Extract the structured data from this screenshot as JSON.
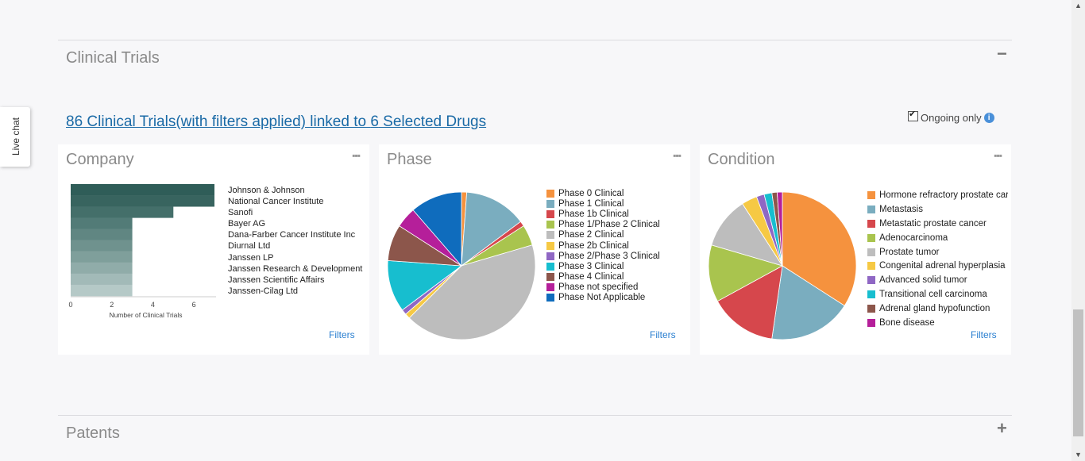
{
  "clinical_trials_section": {
    "title": "Clinical Trials",
    "collapse_icon": "minus-icon",
    "summary": {
      "count": "86",
      "text1": " Clinical Trials(with filters applied) linked to ",
      "drugs": "6",
      "text2": " Selected Drugs"
    },
    "ongoing_label": "Ongoing only",
    "ongoing_checked": true
  },
  "live_chat": {
    "label": "Live chat"
  },
  "patents_section": {
    "title": "Patents",
    "expand_icon": "plus-icon"
  },
  "company_card": {
    "title": "Company",
    "filters_label": "Filters",
    "menu_icon": "ellipsis-icon",
    "xlabel": "Number of Clinical Trials",
    "ticks": [
      "0",
      "2",
      "4",
      "6"
    ],
    "xlim": [
      0,
      7
    ],
    "companies": [
      "Johnson & Johnson",
      "National Cancer Institute",
      "Sanofi",
      "Bayer AG",
      "Dana-Farber Cancer Institute Inc",
      "Diurnal Ltd",
      "Janssen LP",
      "Janssen Research & Development L",
      "Janssen Scientific Affairs",
      "Janssen-Cilag Ltd"
    ],
    "values": [
      7,
      7,
      5,
      3,
      3,
      3,
      3,
      3,
      3,
      3
    ],
    "colors": [
      "#2f5d58",
      "#38645f",
      "#446f6a",
      "#527b77",
      "#608682",
      "#6f928e",
      "#7f9f9b",
      "#90aca9",
      "#a2bab8",
      "#b5c9c7"
    ]
  },
  "phase_card": {
    "title": "Phase",
    "filters_label": "Filters",
    "menu_icon": "ellipsis-icon",
    "legend": [
      {
        "label": "Phase 0 Clinical",
        "color": "#f5923e"
      },
      {
        "label": "Phase 1 Clinical",
        "color": "#7aadbf"
      },
      {
        "label": "Phase 1b Clinical",
        "color": "#d6474c"
      },
      {
        "label": "Phase 1/Phase 2 Clinical",
        "color": "#a9c44e"
      },
      {
        "label": "Phase 2 Clinical",
        "color": "#bdbdbd"
      },
      {
        "label": "Phase 2b Clinical",
        "color": "#f6c944"
      },
      {
        "label": "Phase 2/Phase 3 Clinical",
        "color": "#8f67c4"
      },
      {
        "label": "Phase 3 Clinical",
        "color": "#17becf"
      },
      {
        "label": "Phase 4 Clinical",
        "color": "#8c564b"
      },
      {
        "label": "Phase not specified",
        "color": "#b51f9a"
      },
      {
        "label": "Phase Not Applicable",
        "color": "#0f6cbd"
      }
    ]
  },
  "condition_card": {
    "title": "Condition",
    "filters_label": "Filters",
    "menu_icon": "ellipsis-icon",
    "legend": [
      {
        "label": "Hormone refractory prostate car",
        "color": "#f5923e"
      },
      {
        "label": "Metastasis",
        "color": "#7aadbf"
      },
      {
        "label": "Metastatic prostate cancer",
        "color": "#d6474c"
      },
      {
        "label": "Adenocarcinoma",
        "color": "#a9c44e"
      },
      {
        "label": "Prostate tumor",
        "color": "#bdbdbd"
      },
      {
        "label": "Congenital adrenal hyperplasia",
        "color": "#f6c944"
      },
      {
        "label": "Advanced solid tumor",
        "color": "#8f67c4"
      },
      {
        "label": "Transitional cell carcinoma",
        "color": "#17becf"
      },
      {
        "label": "Adrenal gland hypofunction",
        "color": "#8c564b"
      },
      {
        "label": "Bone disease",
        "color": "#b51f9a"
      }
    ]
  },
  "chart_data": [
    {
      "type": "bar",
      "orientation": "horizontal",
      "title": "Company",
      "xlabel": "Number of Clinical Trials",
      "ylabel": "",
      "xlim": [
        0,
        7
      ],
      "categories": [
        "Johnson & Johnson",
        "National Cancer Institute",
        "Sanofi",
        "Bayer AG",
        "Dana-Farber Cancer Institute Inc",
        "Diurnal Ltd",
        "Janssen LP",
        "Janssen Research & Development L",
        "Janssen Scientific Affairs",
        "Janssen-Cilag Ltd"
      ],
      "values": [
        7,
        7,
        5,
        3,
        3,
        3,
        3,
        3,
        3,
        3
      ]
    },
    {
      "type": "pie",
      "title": "Phase",
      "labels": [
        "Phase 0 Clinical",
        "Phase 1 Clinical",
        "Phase 1b Clinical",
        "Phase 1/Phase 2 Clinical",
        "Phase 2 Clinical",
        "Phase 2b Clinical",
        "Phase 2/Phase 3 Clinical",
        "Phase 3 Clinical",
        "Phase 4 Clinical",
        "Phase not specified",
        "Phase Not Applicable"
      ],
      "values": [
        1,
        12,
        1,
        4,
        37,
        1,
        1,
        10,
        7,
        4,
        10
      ],
      "colors": [
        "#f5923e",
        "#7aadbf",
        "#d6474c",
        "#a9c44e",
        "#bdbdbd",
        "#f6c944",
        "#8f67c4",
        "#17becf",
        "#8c564b",
        "#b51f9a",
        "#0f6cbd"
      ]
    },
    {
      "type": "pie",
      "title": "Condition",
      "labels": [
        "Hormone refractory prostate car",
        "Metastasis",
        "Metastatic prostate cancer",
        "Adenocarcinoma",
        "Prostate tumor",
        "Congenital adrenal hyperplasia",
        "Advanced solid tumor",
        "Transitional cell carcinoma",
        "Adrenal gland hypofunction",
        "Bone disease"
      ],
      "values": [
        30,
        16,
        13,
        11,
        10,
        3,
        1.5,
        1.5,
        1,
        1
      ],
      "colors": [
        "#f5923e",
        "#7aadbf",
        "#d6474c",
        "#a9c44e",
        "#bdbdbd",
        "#f6c944",
        "#8f67c4",
        "#17becf",
        "#8c564b",
        "#b51f9a"
      ]
    }
  ]
}
